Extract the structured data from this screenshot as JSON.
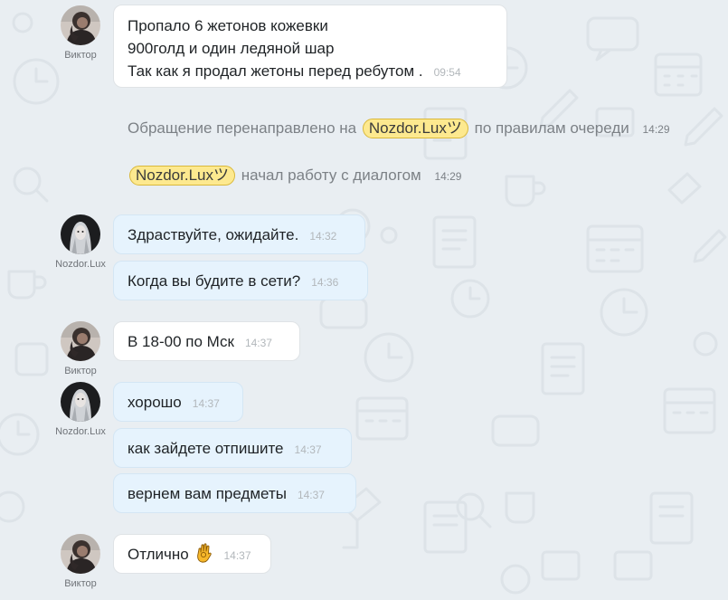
{
  "colors": {
    "background": "#e9eef2",
    "client_bubble": "#ffffff",
    "operator_bubble": "#e6f3fd",
    "operator_chip": "#fde98f",
    "timestamp": "#b2b7bb"
  },
  "users": {
    "client_name": "Виктор",
    "operator_name": "Nozdor.Lux"
  },
  "messages": {
    "m1": {
      "line1": "Пропало 6 жетонов кожевки",
      "line2": "900голд и один ледяной шар",
      "line3": "Так как я продал жетоны перед ребутом .",
      "time": "09:54"
    },
    "sys1": {
      "prefix": "Обращение перенаправлено на",
      "operator": "Nozdor.Luxツ",
      "suffix": "по правилам очереди",
      "time": "14:29"
    },
    "sys2": {
      "operator": "Nozdor.Luxツ",
      "suffix": "начал работу с диалогом",
      "time": "14:29"
    },
    "m2": {
      "text": "Здраствуйте, ожидайте.",
      "time": "14:32"
    },
    "m3": {
      "text": "Когда вы будите в сети?",
      "time": "14:36"
    },
    "m4": {
      "text": "В 18-00 по Мск",
      "time": "14:37"
    },
    "m5": {
      "text": "хорошо",
      "time": "14:37"
    },
    "m6": {
      "text": "как зайдете отпишите",
      "time": "14:37"
    },
    "m7": {
      "text": "вернем вам предметы",
      "time": "14:37"
    },
    "m8": {
      "text": "Отлично",
      "emoji": "ok-hand-emoji",
      "time": "14:37"
    }
  }
}
